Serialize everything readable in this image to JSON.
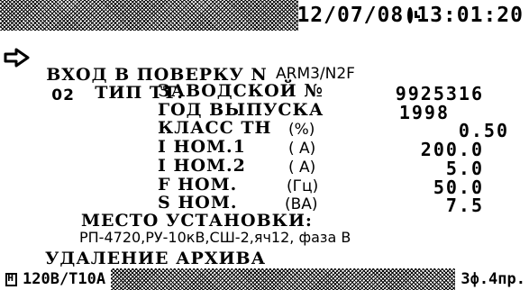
{
  "status_bar": {
    "date": "12/07/08",
    "time": "13:01:20"
  },
  "screen": {
    "title_prefix": "ВХОД В ПОВЕРКУ N",
    "title_number": "02",
    "type_label": "ТИП ТТ:",
    "type_value": "ARM3/N2F",
    "fields": [
      {
        "label": "ЗАВОДСКОЙ №",
        "unit": "",
        "value": "9925316"
      },
      {
        "label": "ГОД ВЫПУСКА",
        "unit": "",
        "value": "1998"
      },
      {
        "label": "КЛАСС ТН",
        "unit": "(%)",
        "value": "0.50"
      },
      {
        "label": "I НОМ.1",
        "unit": "( A)",
        "value": "200.0"
      },
      {
        "label": "I НОМ.2",
        "unit": "( A)",
        "value": "5.0"
      },
      {
        "label": "F НОМ.",
        "unit": "(Гц)",
        "value": "50.0"
      },
      {
        "label": "S НОМ.",
        "unit": "(ВА)",
        "value": "7.5"
      }
    ],
    "location_label": "МЕСТО УСТАНОВКИ:",
    "location_value": "РП-4720,РУ-10кВ,СШ-2,яч12, фаза В",
    "action": "УДАЛЕНИЕ АРХИВА"
  },
  "footer": {
    "voltage": "120В/Т10А",
    "mode": "3ф.4пр."
  }
}
